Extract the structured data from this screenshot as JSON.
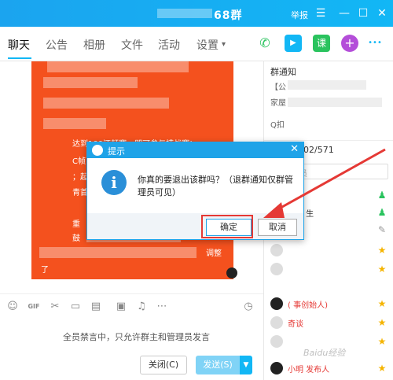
{
  "window": {
    "title": "68群",
    "report_label": "举报",
    "min_icon": "minimize-icon",
    "max_icon": "maximize-icon",
    "close_icon": "close-icon"
  },
  "tabs": [
    {
      "label": "聊天",
      "active": true
    },
    {
      "label": "公告"
    },
    {
      "label": "相册"
    },
    {
      "label": "文件"
    },
    {
      "label": "活动"
    },
    {
      "label": "设置"
    }
  ],
  "toolbar_icons": {
    "phone": "phone-icon",
    "video": "video-icon",
    "class": "课",
    "add": "+",
    "more": "•••"
  },
  "chat": {
    "bubble_color": "#f4511e",
    "fragments": [
      "达到100还赶赛，即可参与摸战赛!",
      "C帧",
      "；起",
      "青首",
      "重",
      "鼓",
      "调整",
      "了"
    ]
  },
  "input": {
    "mute_notice": "全员禁言中，只允许群主和管理员发言",
    "close_label": "关闭(C)",
    "send_label": "发送(S)"
  },
  "sidebar": {
    "notice_title": "群通知",
    "notice_lines": [
      "【公",
      "家屋",
      "Q扣"
    ],
    "member_count": "02/571",
    "search_placeholder": "员",
    "members": [
      {
        "name": "",
        "badge": "admin"
      },
      {
        "name": "东鸥    生",
        "badge": "admin"
      },
      {
        "name": "567",
        "badge": "edit"
      },
      {
        "name": "",
        "badge": "star"
      },
      {
        "name": "",
        "badge": "star"
      },
      {
        "name": "(     事创始人)",
        "badge": "star"
      },
      {
        "name": "奇谈",
        "badge": "star"
      },
      {
        "name": "",
        "badge": "star"
      },
      {
        "name": "小明     发布人",
        "badge": "star"
      }
    ]
  },
  "dialog": {
    "title": "提示",
    "message": "你真的要退出该群吗？（退群通知仅群管理员可见）",
    "ok_label": "确定",
    "cancel_label": "取消"
  },
  "watermark": "Baidu经验"
}
